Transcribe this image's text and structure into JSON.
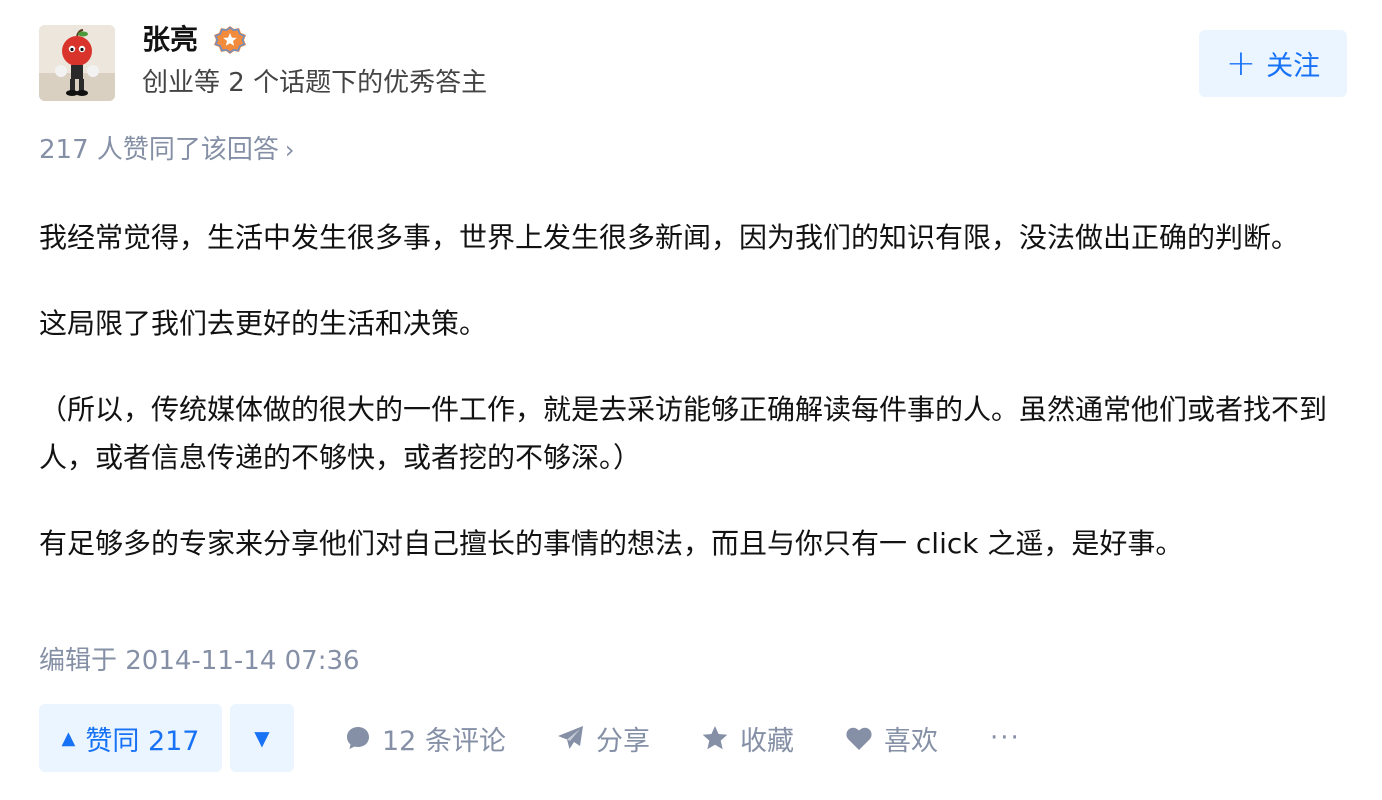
{
  "author": {
    "name": "张亮",
    "headline": "创业等 2 个话题下的优秀答主"
  },
  "follow_button": {
    "label": "关注"
  },
  "voters_text": "217 人赞同了该回答",
  "answer": {
    "paragraphs": [
      "我经常觉得，生活中发生很多事，世界上发生很多新闻，因为我们的知识有限，没法做出正确的判断。",
      "这局限了我们去更好的生活和决策。",
      "（所以，传统媒体做的很大的一件工作，就是去采访能够正确解读每件事的人。虽然通常他们或者找不到人，或者信息传递的不够快，或者挖的不够深。）",
      "有足够多的专家来分享他们对自己擅长的事情的想法，而且与你只有一 click 之遥，是好事。"
    ],
    "edited": "编辑于 2014-11-14 07:36"
  },
  "actions": {
    "vote_up_label": "赞同 217",
    "comments_label": "12 条评论",
    "share_label": "分享",
    "favorite_label": "收藏",
    "like_label": "喜欢",
    "more_label": "···"
  },
  "colors": {
    "accent": "#1772f6",
    "accent_bg": "#ebf5ff",
    "muted": "#8590a6",
    "badge": "#f28b3c"
  }
}
